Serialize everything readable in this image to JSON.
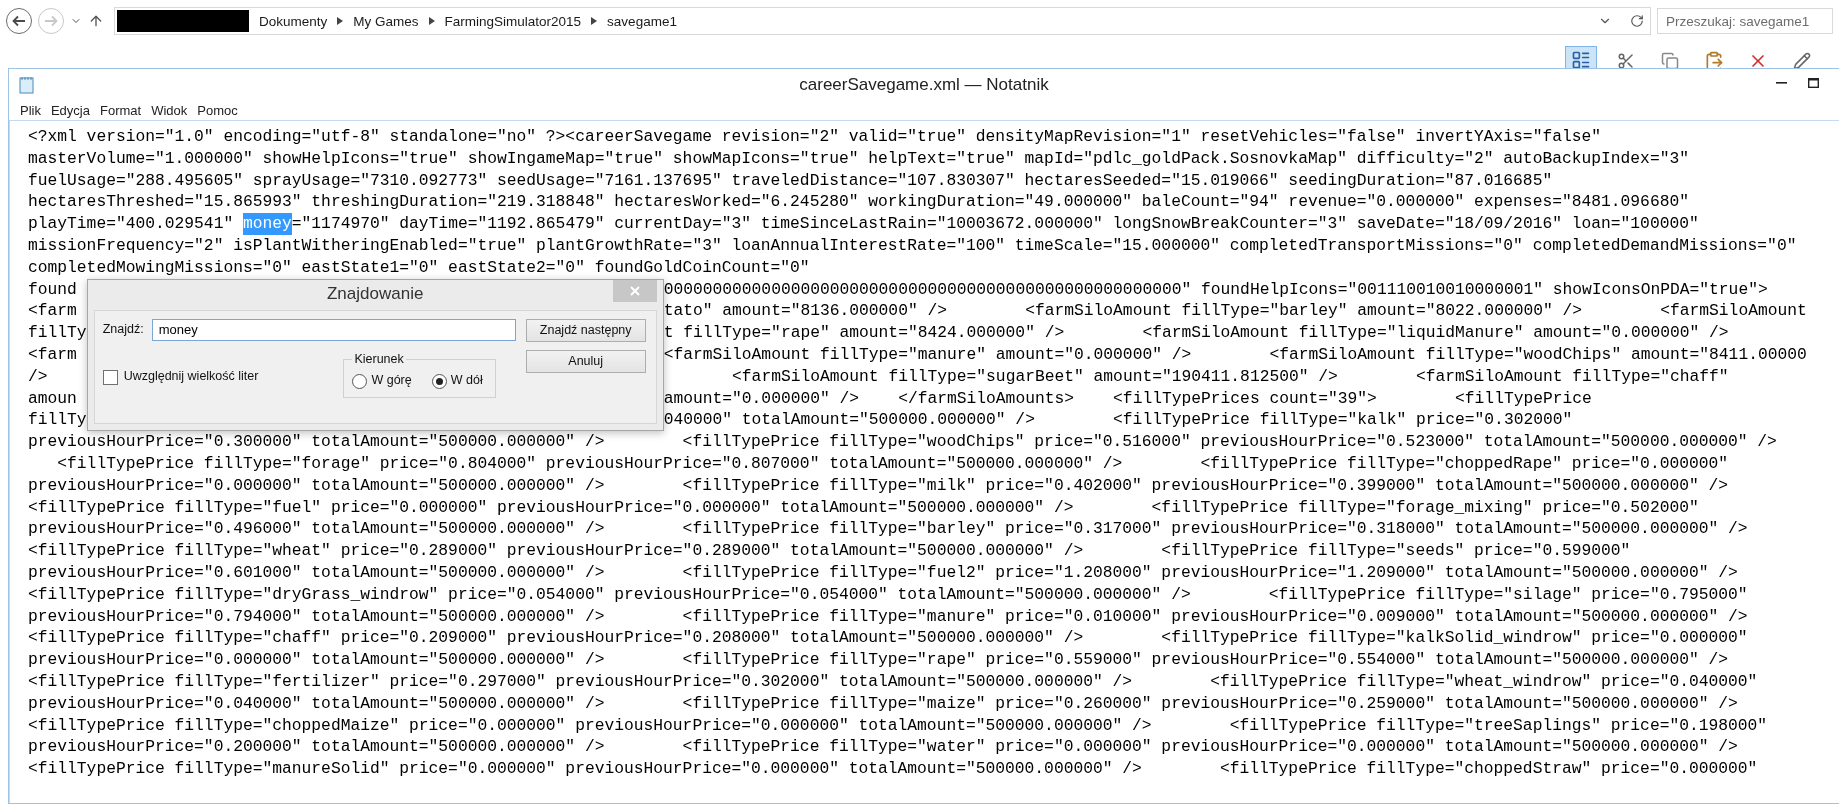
{
  "nav": {
    "back": {
      "disabled": false
    },
    "forward": {
      "disabled": true
    }
  },
  "address": {
    "crumbs": [
      "Dokumenty",
      "My Games",
      "FarmingSimulator2015",
      "savegame1"
    ]
  },
  "search": {
    "placeholder": "Przeszukaj: savegame1"
  },
  "notepad": {
    "title": "careerSavegame.xml — Notatnik",
    "menu": [
      "Plik",
      "Edycja",
      "Format",
      "Widok",
      "Pomoc"
    ],
    "lines": [
      {
        "kind": "plain",
        "text": "<?xml version=\"1.0\" encoding=\"utf-8\" standalone=\"no\" ?><careerSavegame revision=\"2\" valid=\"true\" densityMapRevision=\"1\" resetVehicles=\"false\" invertYAxis=\"false\""
      },
      {
        "kind": "plain",
        "text": "masterVolume=\"1.000000\" showHelpIcons=\"true\" showIngameMap=\"true\" showMapIcons=\"true\" helpText=\"true\" mapId=\"pdlc_goldPack.SosnovkaMap\" difficulty=\"2\" autoBackupIndex=\"3\""
      },
      {
        "kind": "plain",
        "text": "fuelUsage=\"288.495605\" sprayUsage=\"7310.092773\" seedUsage=\"7161.137695\" traveledDistance=\"107.830307\" hectaresSeeded=\"15.019066\" seedingDuration=\"87.016685\""
      },
      {
        "kind": "plain",
        "text": "hectaresThreshed=\"15.865993\" threshingDuration=\"219.318848\" hectaresWorked=\"6.245280\" workingDuration=\"49.000000\" baleCount=\"94\" revenue=\"0.000000\" expenses=\"8481.096680\""
      },
      {
        "kind": "selection",
        "parts": [
          {
            "text": "playTime=\"400.029541\" ",
            "selected": false
          },
          {
            "text": "money",
            "selected": true
          },
          {
            "text": "=\"1174970\" dayTime=\"1192.865479\" currentDay=\"3\" timeSinceLastRain=\"10003672.000000\" longSnowBreakCounter=\"3\" saveDate=\"18/09/2016\" loan=\"100000\"",
            "selected": false
          }
        ]
      },
      {
        "kind": "plain",
        "text": "missionFrequency=\"2\" isPlantWitheringEnabled=\"true\" plantGrowthRate=\"3\" loanAnnualInterestRate=\"100\" timeScale=\"15.000000\" completedTransportMissions=\"0\" completedDemandMissions=\"0\""
      },
      {
        "kind": "plain",
        "text": "completedMowingMissions=\"0\" eastState1=\"0\" eastState2=\"0\" foundGoldCoinCount=\"0\""
      },
      {
        "kind": "covered",
        "left": "found",
        "right": "00000000000000000000000000000000000000000000000000000\" foundHelpIcons=\"001110010010000001\" showIconsOnPDA=\"true\">"
      },
      {
        "kind": "covered",
        "left": "<farm",
        "right": "tato\" amount=\"8136.000000\" />        <farmSiloAmount fillType=\"barley\" amount=\"8022.000000\" />        <farmSiloAmount"
      },
      {
        "kind": "covered",
        "left": "fillTy",
        "right": "t fillType=\"rape\" amount=\"8424.000000\" />        <farmSiloAmount fillType=\"liquidManure\" amount=\"0.000000\" />"
      },
      {
        "kind": "covered",
        "left": "<farm",
        "right": "<farmSiloAmount fillType=\"manure\" amount=\"0.000000\" />        <farmSiloAmount fillType=\"woodChips\" amount=\"8411.00000"
      },
      {
        "kind": "covered",
        "left": "/>",
        "right": "       <farmSiloAmount fillType=\"sugarBeet\" amount=\"190411.812500\" />        <farmSiloAmount fillType=\"chaff\""
      },
      {
        "kind": "covered",
        "left": "amoun",
        "right": "amount=\"0.000000\" />    </farmSiloAmounts>    <fillTypePrices count=\"39\">        <fillTypePrice"
      },
      {
        "kind": "covered",
        "left": "fillTy",
        "right": "040000\" totalAmount=\"500000.000000\" />        <fillTypePrice fillType=\"kalk\" price=\"0.302000\""
      },
      {
        "kind": "plain",
        "text": "previousHourPrice=\"0.300000\" totalAmount=\"500000.000000\" />        <fillTypePrice fillType=\"woodChips\" price=\"0.516000\" previousHourPrice=\"0.523000\" totalAmount=\"500000.000000\" />"
      },
      {
        "kind": "plain",
        "text": "   <fillTypePrice fillType=\"forage\" price=\"0.804000\" previousHourPrice=\"0.807000\" totalAmount=\"500000.000000\" />        <fillTypePrice fillType=\"choppedRape\" price=\"0.000000\""
      },
      {
        "kind": "plain",
        "text": "previousHourPrice=\"0.000000\" totalAmount=\"500000.000000\" />        <fillTypePrice fillType=\"milk\" price=\"0.402000\" previousHourPrice=\"0.399000\" totalAmount=\"500000.000000\" />"
      },
      {
        "kind": "plain",
        "text": "<fillTypePrice fillType=\"fuel\" price=\"0.000000\" previousHourPrice=\"0.000000\" totalAmount=\"500000.000000\" />        <fillTypePrice fillType=\"forage_mixing\" price=\"0.502000\""
      },
      {
        "kind": "plain",
        "text": "previousHourPrice=\"0.496000\" totalAmount=\"500000.000000\" />        <fillTypePrice fillType=\"barley\" price=\"0.317000\" previousHourPrice=\"0.318000\" totalAmount=\"500000.000000\" />"
      },
      {
        "kind": "plain",
        "text": "<fillTypePrice fillType=\"wheat\" price=\"0.289000\" previousHourPrice=\"0.289000\" totalAmount=\"500000.000000\" />        <fillTypePrice fillType=\"seeds\" price=\"0.599000\""
      },
      {
        "kind": "plain",
        "text": "previousHourPrice=\"0.601000\" totalAmount=\"500000.000000\" />        <fillTypePrice fillType=\"fuel2\" price=\"1.208000\" previousHourPrice=\"1.209000\" totalAmount=\"500000.000000\" />"
      },
      {
        "kind": "plain",
        "text": "<fillTypePrice fillType=\"dryGrass_windrow\" price=\"0.054000\" previousHourPrice=\"0.054000\" totalAmount=\"500000.000000\" />        <fillTypePrice fillType=\"silage\" price=\"0.795000\""
      },
      {
        "kind": "plain",
        "text": "previousHourPrice=\"0.794000\" totalAmount=\"500000.000000\" />        <fillTypePrice fillType=\"manure\" price=\"0.010000\" previousHourPrice=\"0.009000\" totalAmount=\"500000.000000\" />"
      },
      {
        "kind": "plain",
        "text": "<fillTypePrice fillType=\"chaff\" price=\"0.209000\" previousHourPrice=\"0.208000\" totalAmount=\"500000.000000\" />        <fillTypePrice fillType=\"kalkSolid_windrow\" price=\"0.000000\""
      },
      {
        "kind": "plain",
        "text": "previousHourPrice=\"0.000000\" totalAmount=\"500000.000000\" />        <fillTypePrice fillType=\"rape\" price=\"0.559000\" previousHourPrice=\"0.554000\" totalAmount=\"500000.000000\" />"
      },
      {
        "kind": "plain",
        "text": "<fillTypePrice fillType=\"fertilizer\" price=\"0.297000\" previousHourPrice=\"0.302000\" totalAmount=\"500000.000000\" />        <fillTypePrice fillType=\"wheat_windrow\" price=\"0.040000\""
      },
      {
        "kind": "plain",
        "text": "previousHourPrice=\"0.040000\" totalAmount=\"500000.000000\" />        <fillTypePrice fillType=\"maize\" price=\"0.260000\" previousHourPrice=\"0.259000\" totalAmount=\"500000.000000\" />"
      },
      {
        "kind": "plain",
        "text": "<fillTypePrice fillType=\"choppedMaize\" price=\"0.000000\" previousHourPrice=\"0.000000\" totalAmount=\"500000.000000\" />        <fillTypePrice fillType=\"treeSaplings\" price=\"0.198000\""
      },
      {
        "kind": "plain",
        "text": "previousHourPrice=\"0.200000\" totalAmount=\"500000.000000\" />        <fillTypePrice fillType=\"water\" price=\"0.000000\" previousHourPrice=\"0.000000\" totalAmount=\"500000.000000\" />"
      },
      {
        "kind": "plain",
        "text": "<fillTypePrice fillType=\"manureSolid\" price=\"0.000000\" previousHourPrice=\"0.000000\" totalAmount=\"500000.000000\" />        <fillTypePrice fillType=\"choppedStraw\" price=\"0.000000\""
      }
    ]
  },
  "find_dialog": {
    "title": "Znajdowanie",
    "find_label": "Znajdź:",
    "find_value": "money",
    "buttons": [
      {
        "label": "Znajdź następny"
      },
      {
        "label": "Anuluj"
      }
    ],
    "direction": {
      "label": "Kierunek",
      "options": [
        {
          "label": "W górę",
          "selected": false
        },
        {
          "label": "W dół",
          "selected": true
        }
      ]
    },
    "match_case": {
      "label": "Uwzględnij wielkość liter",
      "checked": false
    }
  }
}
